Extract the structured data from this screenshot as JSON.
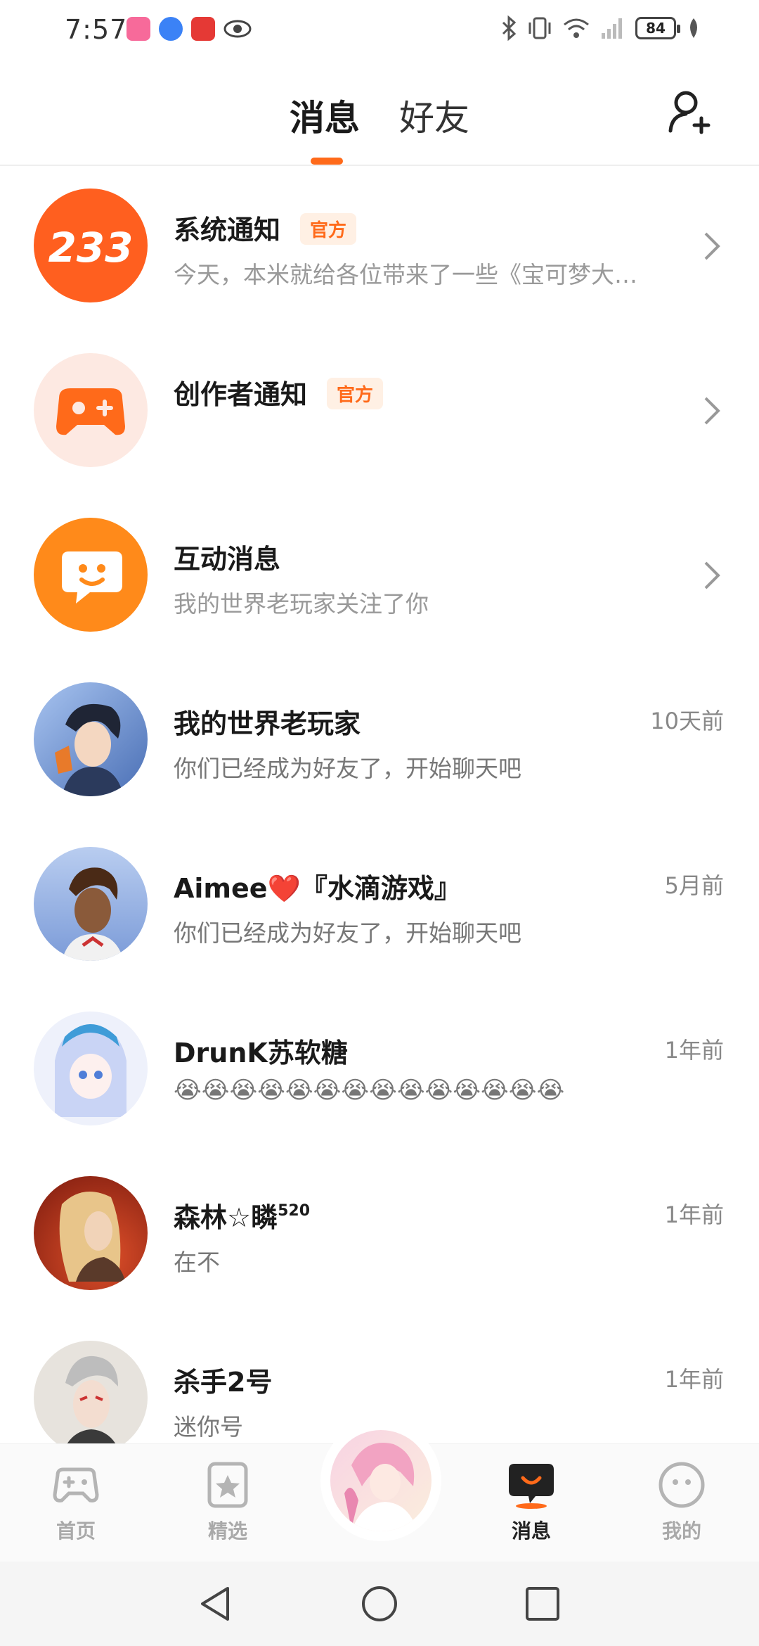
{
  "status_bar": {
    "time": "7:57",
    "battery": "84",
    "icons": [
      "bluetooth-icon",
      "vibrate-icon",
      "wifi-icon",
      "signal-icon"
    ]
  },
  "header": {
    "tabs": [
      {
        "label": "消息",
        "active": true
      },
      {
        "label": "好友",
        "active": false
      }
    ],
    "add_friend_icon": "add-person-icon"
  },
  "conversations": [
    {
      "name": "系统通知",
      "badge": "官方",
      "preview": "今天，本米就给各位带来了一些《宝可梦大…",
      "time": "",
      "avatar_text": "233",
      "avatar_color": "#ff5f1f",
      "chevron": true
    },
    {
      "name": "创作者通知",
      "badge": "官方",
      "preview": "",
      "time": "",
      "avatar_color": "#fde9e2",
      "chevron": true
    },
    {
      "name": "互动消息",
      "badge": "",
      "preview": "我的世界老玩家关注了你",
      "time": "",
      "avatar_color": "#ff8a1a",
      "chevron": true
    },
    {
      "name": "我的世界老玩家",
      "preview": "你们已经成为好友了，开始聊天吧",
      "time": "10天前"
    },
    {
      "name": "Aimee❤️『水滴游戏』",
      "preview": "你们已经成为好友了，开始聊天吧",
      "time": "5月前"
    },
    {
      "name": "DrunK苏软糖",
      "preview": "😭😭😭😭😭😭😭😭😭😭😭😭😭😭",
      "time": "1年前"
    },
    {
      "name": "森林☆瞵",
      "name_sup": "520",
      "preview": "在不",
      "time": "1年前"
    },
    {
      "name": "杀手2号",
      "preview": "迷你号",
      "time": "1年前"
    }
  ],
  "bottom_nav": {
    "items": [
      {
        "label": "首页",
        "icon": "gamepad-icon",
        "active": false
      },
      {
        "label": "精选",
        "icon": "star-bookmark-icon",
        "active": false
      },
      {
        "label": "消息",
        "icon": "chat-bubble-icon",
        "active": true
      },
      {
        "label": "我的",
        "icon": "face-icon",
        "active": false
      }
    ]
  },
  "colors": {
    "accent": "#ff6a1a",
    "muted": "#999999"
  }
}
